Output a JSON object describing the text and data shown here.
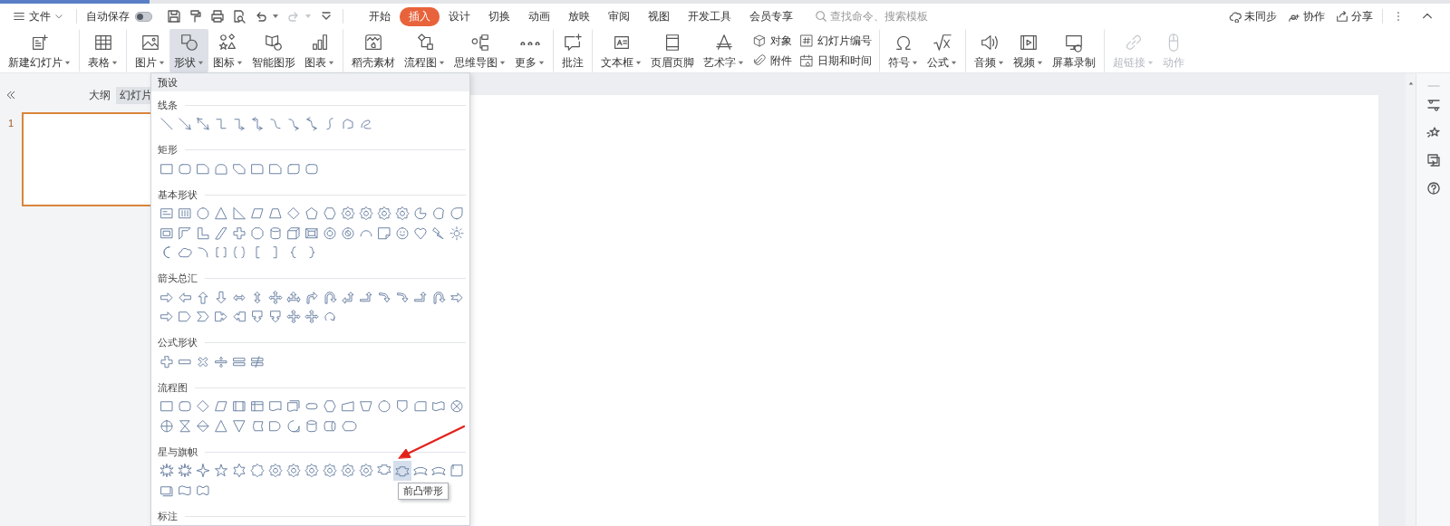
{
  "menubar": {
    "file_label": "文件",
    "autosave": {
      "label": "自动保存",
      "on": false
    },
    "quick_access": [
      {
        "disabled": false
      },
      {
        "disabled": false
      },
      {
        "disabled": false
      },
      {
        "disabled": false
      },
      {
        "disabled": false
      },
      {
        "disabled": true
      },
      {
        "disabled": false
      }
    ],
    "tabs": [
      {
        "label": "开始",
        "selected": false
      },
      {
        "label": "插入",
        "selected": true
      },
      {
        "label": "设计",
        "selected": false
      },
      {
        "label": "切换",
        "selected": false
      },
      {
        "label": "动画",
        "selected": false
      },
      {
        "label": "放映",
        "selected": false
      },
      {
        "label": "审阅",
        "selected": false
      },
      {
        "label": "视图",
        "selected": false
      },
      {
        "label": "开发工具",
        "selected": false
      },
      {
        "label": "会员专享",
        "selected": false
      }
    ],
    "search": {
      "placeholder": "查找命令、搜索模板"
    },
    "actions": [
      {
        "label": "未同步"
      },
      {
        "label": "协作"
      },
      {
        "label": "分享"
      }
    ]
  },
  "ribbon": [
    {
      "kind": "large",
      "label": "新建幻灯片",
      "dropdown": true,
      "selected": false,
      "disabled": false,
      "divider_before": false
    },
    {
      "kind": "large",
      "label": "表格",
      "dropdown": true,
      "selected": false,
      "disabled": false,
      "divider_before": true
    },
    {
      "kind": "large",
      "label": "图片",
      "dropdown": true,
      "selected": false,
      "disabled": false,
      "divider_before": true
    },
    {
      "kind": "large",
      "label": "形状",
      "dropdown": true,
      "selected": true,
      "disabled": false,
      "divider_before": false
    },
    {
      "kind": "large",
      "label": "图标",
      "dropdown": true,
      "selected": false,
      "disabled": false,
      "divider_before": false
    },
    {
      "kind": "large",
      "label": "智能图形",
      "dropdown": false,
      "selected": false,
      "disabled": false,
      "divider_before": false
    },
    {
      "kind": "large",
      "label": "图表",
      "dropdown": true,
      "selected": false,
      "disabled": false,
      "divider_before": false
    },
    {
      "kind": "large",
      "label": "稻壳素材",
      "dropdown": false,
      "selected": false,
      "disabled": false,
      "divider_before": true
    },
    {
      "kind": "large",
      "label": "流程图",
      "dropdown": true,
      "selected": false,
      "disabled": false,
      "divider_before": false
    },
    {
      "kind": "large",
      "label": "思维导图",
      "dropdown": true,
      "selected": false,
      "disabled": false,
      "divider_before": false
    },
    {
      "kind": "large",
      "label": "更多",
      "dropdown": true,
      "selected": false,
      "disabled": false,
      "divider_before": false
    },
    {
      "kind": "large",
      "label": "批注",
      "dropdown": false,
      "selected": false,
      "disabled": false,
      "divider_before": true
    },
    {
      "kind": "large",
      "label": "文本框",
      "dropdown": true,
      "selected": false,
      "disabled": false,
      "divider_before": true
    },
    {
      "kind": "large",
      "label": "页眉页脚",
      "dropdown": false,
      "selected": false,
      "disabled": false,
      "divider_before": false
    },
    {
      "kind": "large",
      "label": "艺术字",
      "dropdown": true,
      "selected": false,
      "disabled": false,
      "divider_before": false
    },
    {
      "kind": "pair",
      "items": [
        {
          "label": "对象"
        },
        {
          "label": "附件"
        }
      ],
      "divider_before": false
    },
    {
      "kind": "pair",
      "items": [
        {
          "label": "幻灯片编号"
        },
        {
          "label": "日期和时间"
        }
      ],
      "divider_before": false
    },
    {
      "kind": "large",
      "label": "符号",
      "dropdown": true,
      "selected": false,
      "disabled": false,
      "divider_before": true
    },
    {
      "kind": "large",
      "label": "公式",
      "dropdown": true,
      "selected": false,
      "disabled": false,
      "divider_before": false
    },
    {
      "kind": "large",
      "label": "音频",
      "dropdown": true,
      "selected": false,
      "disabled": false,
      "divider_before": true
    },
    {
      "kind": "large",
      "label": "视频",
      "dropdown": true,
      "selected": false,
      "disabled": false,
      "divider_before": false
    },
    {
      "kind": "large",
      "label": "屏幕录制",
      "dropdown": false,
      "selected": false,
      "disabled": false,
      "divider_before": false
    },
    {
      "kind": "large",
      "label": "超链接",
      "dropdown": true,
      "selected": false,
      "disabled": true,
      "divider_before": true
    },
    {
      "kind": "large",
      "label": "动作",
      "dropdown": false,
      "selected": false,
      "disabled": true,
      "divider_before": false
    }
  ],
  "side_panel": {
    "tabs": [
      {
        "label": "大纲",
        "selected": false
      },
      {
        "label": "幻灯片",
        "selected": true
      }
    ],
    "slides": [
      {
        "number": "1",
        "selected": true
      }
    ]
  },
  "shape_gallery": {
    "header": "预设",
    "sections": [
      {
        "title": "线条",
        "shapes": [
          {
            "hovered": false
          },
          {
            "hovered": false
          },
          {
            "hovered": false
          },
          {
            "hovered": false
          },
          {
            "hovered": false
          },
          {
            "hovered": false
          },
          {
            "hovered": false
          },
          {
            "hovered": false
          },
          {
            "hovered": false
          },
          {
            "hovered": false
          },
          {
            "hovered": false
          },
          {
            "hovered": false
          }
        ]
      },
      {
        "title": "矩形",
        "shapes": [
          {
            "hovered": false
          },
          {
            "hovered": false
          },
          {
            "hovered": false
          },
          {
            "hovered": false
          },
          {
            "hovered": false
          },
          {
            "hovered": false
          },
          {
            "hovered": false
          },
          {
            "hovered": false
          },
          {
            "hovered": false
          }
        ]
      },
      {
        "title": "基本形状",
        "shapes": [
          {
            "hovered": false
          },
          {
            "hovered": false
          },
          {
            "hovered": false
          },
          {
            "hovered": false
          },
          {
            "hovered": false
          },
          {
            "hovered": false
          },
          {
            "hovered": false
          },
          {
            "hovered": false
          },
          {
            "hovered": false
          },
          {
            "hovered": false
          },
          {
            "hovered": false
          },
          {
            "hovered": false
          },
          {
            "hovered": false
          },
          {
            "hovered": false
          },
          {
            "hovered": false
          },
          {
            "hovered": false
          },
          {
            "hovered": false
          },
          {
            "hovered": false
          },
          {
            "hovered": false
          },
          {
            "hovered": false
          },
          {
            "hovered": false
          },
          {
            "hovered": false
          },
          {
            "hovered": false
          },
          {
            "hovered": false
          },
          {
            "hovered": false
          },
          {
            "hovered": false
          },
          {
            "hovered": false
          },
          {
            "hovered": false
          },
          {
            "hovered": false
          },
          {
            "hovered": false
          },
          {
            "hovered": false
          },
          {
            "hovered": false
          },
          {
            "hovered": false
          },
          {
            "hovered": false
          },
          {
            "hovered": false
          },
          {
            "hovered": false
          },
          {
            "hovered": false
          },
          {
            "hovered": false
          },
          {
            "hovered": false
          },
          {
            "hovered": false
          },
          {
            "hovered": false
          },
          {
            "hovered": false
          },
          {
            "hovered": false
          }
        ]
      },
      {
        "title": "箭头总汇",
        "shapes": [
          {
            "hovered": false
          },
          {
            "hovered": false
          },
          {
            "hovered": false
          },
          {
            "hovered": false
          },
          {
            "hovered": false
          },
          {
            "hovered": false
          },
          {
            "hovered": false
          },
          {
            "hovered": false
          },
          {
            "hovered": false
          },
          {
            "hovered": false
          },
          {
            "hovered": false
          },
          {
            "hovered": false
          },
          {
            "hovered": false
          },
          {
            "hovered": false
          },
          {
            "hovered": false
          },
          {
            "hovered": false
          },
          {
            "hovered": false
          },
          {
            "hovered": false
          },
          {
            "hovered": false
          },
          {
            "hovered": false
          },
          {
            "hovered": false
          },
          {
            "hovered": false
          },
          {
            "hovered": false
          },
          {
            "hovered": false
          },
          {
            "hovered": false
          },
          {
            "hovered": false
          },
          {
            "hovered": false
          }
        ]
      },
      {
        "title": "公式形状",
        "shapes": [
          {
            "hovered": false
          },
          {
            "hovered": false
          },
          {
            "hovered": false
          },
          {
            "hovered": false
          },
          {
            "hovered": false
          },
          {
            "hovered": false
          }
        ]
      },
      {
        "title": "流程图",
        "shapes": [
          {
            "hovered": false
          },
          {
            "hovered": false
          },
          {
            "hovered": false
          },
          {
            "hovered": false
          },
          {
            "hovered": false
          },
          {
            "hovered": false
          },
          {
            "hovered": false
          },
          {
            "hovered": false
          },
          {
            "hovered": false
          },
          {
            "hovered": false
          },
          {
            "hovered": false
          },
          {
            "hovered": false
          },
          {
            "hovered": false
          },
          {
            "hovered": false
          },
          {
            "hovered": false
          },
          {
            "hovered": false
          },
          {
            "hovered": false
          },
          {
            "hovered": false
          },
          {
            "hovered": false
          },
          {
            "hovered": false
          },
          {
            "hovered": false
          },
          {
            "hovered": false
          },
          {
            "hovered": false
          },
          {
            "hovered": false
          },
          {
            "hovered": false
          },
          {
            "hovered": false
          },
          {
            "hovered": false
          },
          {
            "hovered": false
          }
        ]
      },
      {
        "title": "星与旗帜",
        "shapes": [
          {
            "hovered": false
          },
          {
            "hovered": false
          },
          {
            "hovered": false
          },
          {
            "hovered": false
          },
          {
            "hovered": false
          },
          {
            "hovered": false
          },
          {
            "hovered": false
          },
          {
            "hovered": false
          },
          {
            "hovered": false
          },
          {
            "hovered": false
          },
          {
            "hovered": false
          },
          {
            "hovered": false
          },
          {
            "hovered": false
          },
          {
            "hovered": true,
            "tooltip": "前凸带形"
          },
          {
            "hovered": false
          },
          {
            "hovered": false
          },
          {
            "hovered": false
          },
          {
            "hovered": false
          },
          {
            "hovered": false
          },
          {
            "hovered": false
          }
        ]
      },
      {
        "title": "标注"
      }
    ]
  }
}
